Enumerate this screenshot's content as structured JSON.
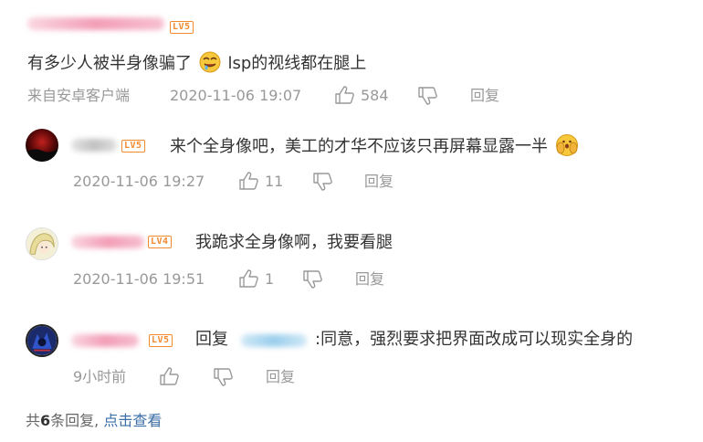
{
  "top_comment": {
    "level": "LV5",
    "text_before_emoji": "有多少人被半身像骗了",
    "emoji": "drool-face-emoji",
    "text_after_emoji": "lsp的视线都在腿上",
    "source": "来自安卓客户端",
    "time": "2020-11-06 19:07",
    "likes": "584",
    "reply_label": "回复"
  },
  "replies": [
    {
      "level": "LV5",
      "text": "来个全身像吧，美工的才华不应该只再屏幕显露一半",
      "emoji": "cover-face-emoji",
      "time": "2020-11-06 19:27",
      "likes": "11",
      "reply_label": "回复"
    },
    {
      "level": "LV4",
      "text": "我跪求全身像啊，我要看腿",
      "time": "2020-11-06 19:51",
      "likes": "1",
      "reply_label": "回复"
    },
    {
      "level": "LV5",
      "reply_prefix": "回复",
      "text": ":同意，强烈要求把界面改成可以现实全身的",
      "time": "9小时前",
      "reply_label": "回复"
    }
  ],
  "summary": {
    "prefix": "共",
    "count": "6",
    "suffix": "条回复,",
    "view_link": "点击查看"
  },
  "colors": {
    "level_badge": "#f28a30",
    "link": "#3a6ea8",
    "meta_text": "#999999",
    "body_text": "#333333"
  }
}
